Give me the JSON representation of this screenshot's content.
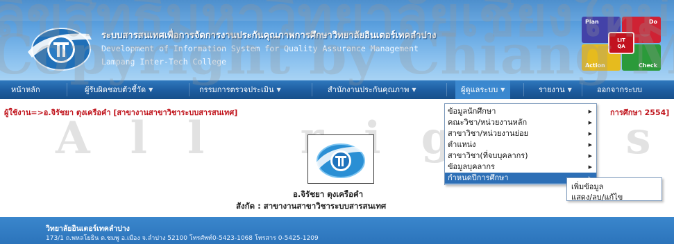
{
  "header": {
    "title_th": "ระบบสารสนเทศเพื่อการจัดการงานประกันคุณภาพการศึกษาวิทยาลัยอินเตอร์เทคลำปาง",
    "title_en": "Development of Information System for Quality Assurance Management",
    "college_en": "Lampang Inter-Tech College",
    "pdca": {
      "plan": "Plan",
      "do": "Do",
      "act": "Action",
      "check": "Check",
      "center_top": "LIT",
      "center_bottom": "QA"
    }
  },
  "nav": [
    {
      "label": "หน้าหลัก",
      "dropdown": false
    },
    {
      "label": "ผู้รับผิดชอบตัวชี้วัด",
      "dropdown": true
    },
    {
      "label": "กรรมการตรวจประเมิน",
      "dropdown": true
    },
    {
      "label": "สำนักงานประกันคุณภาพ",
      "dropdown": true
    },
    {
      "label": "ผู้ดูแลระบบ",
      "dropdown": true
    },
    {
      "label": "รายงาน",
      "dropdown": true
    },
    {
      "label": "ออกจากระบบ",
      "dropdown": false
    }
  ],
  "user_line": "ผู้ใช้งาน=>อ.จิรัชยา ตุงเครือคำ [สาขางานสาขาวิชาระบบสารสนเทศ]",
  "user_line_right": "การศึกษา 2554]",
  "dropdown": [
    {
      "label": "ข้อมูลนักศึกษา",
      "has_sub": true
    },
    {
      "label": "คณะวิชา/หน่วยงานหลัก",
      "has_sub": true
    },
    {
      "label": "สาขาวิชา/หน่วยงานย่อย",
      "has_sub": true
    },
    {
      "label": "ตำแหน่ง",
      "has_sub": true
    },
    {
      "label": "สาขาวิชา(ที่จบบุคลากร)",
      "has_sub": true
    },
    {
      "label": "ข้อมูลบุคลากร",
      "has_sub": true
    },
    {
      "label": "กำหนดปีการศึกษา",
      "has_sub": true
    }
  ],
  "submenu": [
    "เพิ่มข้อมูล",
    "แสดง/ลบ/แก้ไข"
  ],
  "person": {
    "name": "อ.จิรัชยา ตุงเครือคำ",
    "dept": "สังกัด : สาขางานสาขาวิชาระบบสารสนเทศ"
  },
  "footer": {
    "title": "วิทยาลัยอินเตอร์เทคลำปาง",
    "address": "173/1 ถ.พหลโยธิน ต.ชมพู อ.เมือง จ.ลำปาง 52100 โทรศัพท์0-5423-1068 โทรสาร 0-5425-1209"
  },
  "watermark": {
    "line1": "ลิขสิทธิ์มหาวิทยาลัยเชียงใหม่",
    "line2": "Copyright by Chiang Mai University",
    "line3": "All rights reserved"
  },
  "colors": {
    "nav_bg": "#1d5c9f",
    "accent_red": "#c0141c",
    "menu_hover": "#2d6fb6"
  }
}
